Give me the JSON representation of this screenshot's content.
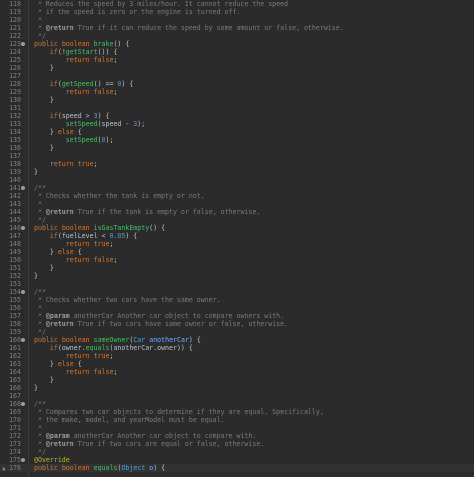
{
  "lines": [
    {
      "n": "118",
      "tokens": [
        [
          "t-comment",
          " * Reduces the speed by 3 miles/hour. It cannot reduce the speed"
        ]
      ]
    },
    {
      "n": "119",
      "tokens": [
        [
          "t-comment",
          " * if the speed is zero or the engine is turned off."
        ]
      ]
    },
    {
      "n": "120",
      "tokens": [
        [
          "t-comment",
          " *"
        ]
      ]
    },
    {
      "n": "121",
      "tokens": [
        [
          "t-comment",
          " * "
        ],
        [
          "t-tag",
          "@return"
        ],
        [
          "t-comment",
          " True if it can reduce the speed by some amount or false, otherwise."
        ]
      ]
    },
    {
      "n": "122",
      "tokens": [
        [
          "t-comment",
          " */"
        ]
      ]
    },
    {
      "n": "123",
      "marker": true,
      "tokens": [
        [
          "t-kw",
          "public"
        ],
        [
          "t-plain",
          " "
        ],
        [
          "t-kw",
          "boolean"
        ],
        [
          "t-plain",
          " "
        ],
        [
          "t-fn",
          "brake"
        ],
        [
          "t-plain",
          "() {"
        ]
      ]
    },
    {
      "n": "124",
      "tokens": [
        [
          "t-plain",
          "    "
        ],
        [
          "t-kw",
          "if"
        ],
        [
          "t-plain",
          "(!"
        ],
        [
          "t-fn",
          "getStart"
        ],
        [
          "t-plain",
          "()) {"
        ]
      ]
    },
    {
      "n": "125",
      "tokens": [
        [
          "t-plain",
          "        "
        ],
        [
          "t-kw",
          "return"
        ],
        [
          "t-plain",
          " "
        ],
        [
          "t-kw",
          "false"
        ],
        [
          "t-plain",
          ";"
        ]
      ]
    },
    {
      "n": "126",
      "tokens": [
        [
          "t-plain",
          "    }"
        ]
      ]
    },
    {
      "n": "127",
      "tokens": []
    },
    {
      "n": "128",
      "tokens": [
        [
          "t-plain",
          "    "
        ],
        [
          "t-kw",
          "if"
        ],
        [
          "t-plain",
          "("
        ],
        [
          "t-fn",
          "getSpeed"
        ],
        [
          "t-plain",
          "() == "
        ],
        [
          "t-num",
          "0"
        ],
        [
          "t-plain",
          ") {"
        ]
      ]
    },
    {
      "n": "129",
      "tokens": [
        [
          "t-plain",
          "        "
        ],
        [
          "t-kw",
          "return"
        ],
        [
          "t-plain",
          " "
        ],
        [
          "t-kw",
          "false"
        ],
        [
          "t-plain",
          ";"
        ]
      ]
    },
    {
      "n": "130",
      "tokens": [
        [
          "t-plain",
          "    }"
        ]
      ]
    },
    {
      "n": "131",
      "tokens": []
    },
    {
      "n": "132",
      "tokens": [
        [
          "t-plain",
          "    "
        ],
        [
          "t-kw",
          "if"
        ],
        [
          "t-plain",
          "(speed > "
        ],
        [
          "t-num",
          "3"
        ],
        [
          "t-plain",
          ") {"
        ]
      ]
    },
    {
      "n": "133",
      "tokens": [
        [
          "t-plain",
          "        "
        ],
        [
          "t-fn",
          "setSpeed"
        ],
        [
          "t-plain",
          "(speed - "
        ],
        [
          "t-num",
          "3"
        ],
        [
          "t-plain",
          ");"
        ]
      ]
    },
    {
      "n": "134",
      "tokens": [
        [
          "t-plain",
          "    } "
        ],
        [
          "t-kw",
          "else"
        ],
        [
          "t-plain",
          " {"
        ]
      ]
    },
    {
      "n": "135",
      "tokens": [
        [
          "t-plain",
          "        "
        ],
        [
          "t-fn",
          "setSpeed"
        ],
        [
          "t-plain",
          "("
        ],
        [
          "t-num",
          "0"
        ],
        [
          "t-plain",
          ");"
        ]
      ]
    },
    {
      "n": "136",
      "tokens": [
        [
          "t-plain",
          "    }"
        ]
      ]
    },
    {
      "n": "137",
      "tokens": []
    },
    {
      "n": "138",
      "tokens": [
        [
          "t-plain",
          "    "
        ],
        [
          "t-kw",
          "return"
        ],
        [
          "t-plain",
          " "
        ],
        [
          "t-kw",
          "true"
        ],
        [
          "t-plain",
          ";"
        ]
      ]
    },
    {
      "n": "139",
      "tokens": [
        [
          "t-plain",
          "}"
        ]
      ]
    },
    {
      "n": "140",
      "tokens": []
    },
    {
      "n": "141",
      "marker": true,
      "tokens": [
        [
          "t-comment",
          "/**"
        ]
      ]
    },
    {
      "n": "142",
      "tokens": [
        [
          "t-comment",
          " * Checks whether the tank is empty or not."
        ]
      ]
    },
    {
      "n": "143",
      "tokens": [
        [
          "t-comment",
          " *"
        ]
      ]
    },
    {
      "n": "144",
      "tokens": [
        [
          "t-comment",
          " * "
        ],
        [
          "t-tag",
          "@return"
        ],
        [
          "t-comment",
          " True if the tank is empty or false, otherwise."
        ]
      ]
    },
    {
      "n": "145",
      "tokens": [
        [
          "t-comment",
          " */"
        ]
      ]
    },
    {
      "n": "146",
      "marker": true,
      "tokens": [
        [
          "t-kw",
          "public"
        ],
        [
          "t-plain",
          " "
        ],
        [
          "t-kw",
          "boolean"
        ],
        [
          "t-plain",
          " "
        ],
        [
          "t-fn",
          "isGasTankEmpty"
        ],
        [
          "t-plain",
          "() {"
        ]
      ]
    },
    {
      "n": "147",
      "tokens": [
        [
          "t-plain",
          "    "
        ],
        [
          "t-kw",
          "if"
        ],
        [
          "t-plain",
          "(fuelLevel < "
        ],
        [
          "t-num",
          "0.05"
        ],
        [
          "t-plain",
          ") {"
        ]
      ]
    },
    {
      "n": "148",
      "tokens": [
        [
          "t-plain",
          "        "
        ],
        [
          "t-kw",
          "return"
        ],
        [
          "t-plain",
          " "
        ],
        [
          "t-kw",
          "true"
        ],
        [
          "t-plain",
          ";"
        ]
      ]
    },
    {
      "n": "149",
      "tokens": [
        [
          "t-plain",
          "    } "
        ],
        [
          "t-kw",
          "else"
        ],
        [
          "t-plain",
          " {"
        ]
      ]
    },
    {
      "n": "150",
      "tokens": [
        [
          "t-plain",
          "        "
        ],
        [
          "t-kw",
          "return"
        ],
        [
          "t-plain",
          " "
        ],
        [
          "t-kw",
          "false"
        ],
        [
          "t-plain",
          ";"
        ]
      ]
    },
    {
      "n": "151",
      "tokens": [
        [
          "t-plain",
          "    }"
        ]
      ]
    },
    {
      "n": "152",
      "tokens": [
        [
          "t-plain",
          "}"
        ]
      ]
    },
    {
      "n": "153",
      "tokens": []
    },
    {
      "n": "154",
      "marker": true,
      "tokens": [
        [
          "t-comment",
          "/**"
        ]
      ]
    },
    {
      "n": "155",
      "tokens": [
        [
          "t-comment",
          " * Checks whether two cars have the same owner."
        ]
      ]
    },
    {
      "n": "156",
      "tokens": [
        [
          "t-comment",
          " *"
        ]
      ]
    },
    {
      "n": "157",
      "tokens": [
        [
          "t-comment",
          " * "
        ],
        [
          "t-tag",
          "@param"
        ],
        [
          "t-comment",
          " anotherCar Another car object to compare owners with."
        ]
      ]
    },
    {
      "n": "158",
      "tokens": [
        [
          "t-comment",
          " * "
        ],
        [
          "t-tag",
          "@return"
        ],
        [
          "t-comment",
          " True if two cars have same owner or false, otherwise."
        ]
      ]
    },
    {
      "n": "159",
      "tokens": [
        [
          "t-comment",
          " */"
        ]
      ]
    },
    {
      "n": "160",
      "marker": true,
      "tokens": [
        [
          "t-kw",
          "public"
        ],
        [
          "t-plain",
          " "
        ],
        [
          "t-kw",
          "boolean"
        ],
        [
          "t-plain",
          " "
        ],
        [
          "t-fn",
          "sameOwner"
        ],
        [
          "t-plain",
          "("
        ],
        [
          "t-type",
          "Car"
        ],
        [
          "t-plain",
          " "
        ],
        [
          "t-param",
          "anotherCar"
        ],
        [
          "t-plain",
          ") {"
        ]
      ]
    },
    {
      "n": "161",
      "tokens": [
        [
          "t-plain",
          "    "
        ],
        [
          "t-kw",
          "if"
        ],
        [
          "t-plain",
          "(owner."
        ],
        [
          "t-fn",
          "equals"
        ],
        [
          "t-plain",
          "(anotherCar.owner)) {"
        ]
      ]
    },
    {
      "n": "162",
      "tokens": [
        [
          "t-plain",
          "        "
        ],
        [
          "t-kw",
          "return"
        ],
        [
          "t-plain",
          " "
        ],
        [
          "t-kw",
          "true"
        ],
        [
          "t-plain",
          ";"
        ]
      ]
    },
    {
      "n": "163",
      "tokens": [
        [
          "t-plain",
          "    } "
        ],
        [
          "t-kw",
          "else"
        ],
        [
          "t-plain",
          " {"
        ]
      ]
    },
    {
      "n": "164",
      "tokens": [
        [
          "t-plain",
          "        "
        ],
        [
          "t-kw",
          "return"
        ],
        [
          "t-plain",
          " "
        ],
        [
          "t-kw",
          "false"
        ],
        [
          "t-plain",
          ";"
        ]
      ]
    },
    {
      "n": "165",
      "tokens": [
        [
          "t-plain",
          "    }"
        ]
      ]
    },
    {
      "n": "166",
      "tokens": [
        [
          "t-plain",
          "}"
        ]
      ]
    },
    {
      "n": "167",
      "tokens": []
    },
    {
      "n": "168",
      "marker": true,
      "tokens": [
        [
          "t-comment",
          "/**"
        ]
      ]
    },
    {
      "n": "169",
      "tokens": [
        [
          "t-comment",
          " * Compares two car objects to determine if they are equal. Specifically,"
        ]
      ]
    },
    {
      "n": "170",
      "tokens": [
        [
          "t-comment",
          " * the make, model, and yearModel must be equal."
        ]
      ]
    },
    {
      "n": "171",
      "tokens": [
        [
          "t-comment",
          " *"
        ]
      ]
    },
    {
      "n": "172",
      "tokens": [
        [
          "t-comment",
          " * "
        ],
        [
          "t-tag",
          "@param"
        ],
        [
          "t-comment",
          " anotherCar Another car object to compare with."
        ]
      ]
    },
    {
      "n": "173",
      "tokens": [
        [
          "t-comment",
          " * "
        ],
        [
          "t-tag",
          "@return"
        ],
        [
          "t-comment",
          " True if two cars are equal or false, otherwise."
        ]
      ]
    },
    {
      "n": "174",
      "tokens": [
        [
          "t-comment",
          " */"
        ]
      ]
    },
    {
      "n": "175",
      "marker": true,
      "tokens": [
        [
          "t-annot",
          "@Override"
        ]
      ]
    },
    {
      "n": "176",
      "warn": true,
      "cur": true,
      "tokens": [
        [
          "t-kw",
          "public"
        ],
        [
          "t-plain",
          " "
        ],
        [
          "t-kw",
          "boolean"
        ],
        [
          "t-plain",
          " "
        ],
        [
          "t-fn",
          "equals"
        ],
        [
          "t-plain",
          "("
        ],
        [
          "t-type",
          "Object"
        ],
        [
          "t-plain",
          " "
        ],
        [
          "t-param",
          "o"
        ],
        [
          "t-plain",
          ") {"
        ]
      ]
    }
  ]
}
